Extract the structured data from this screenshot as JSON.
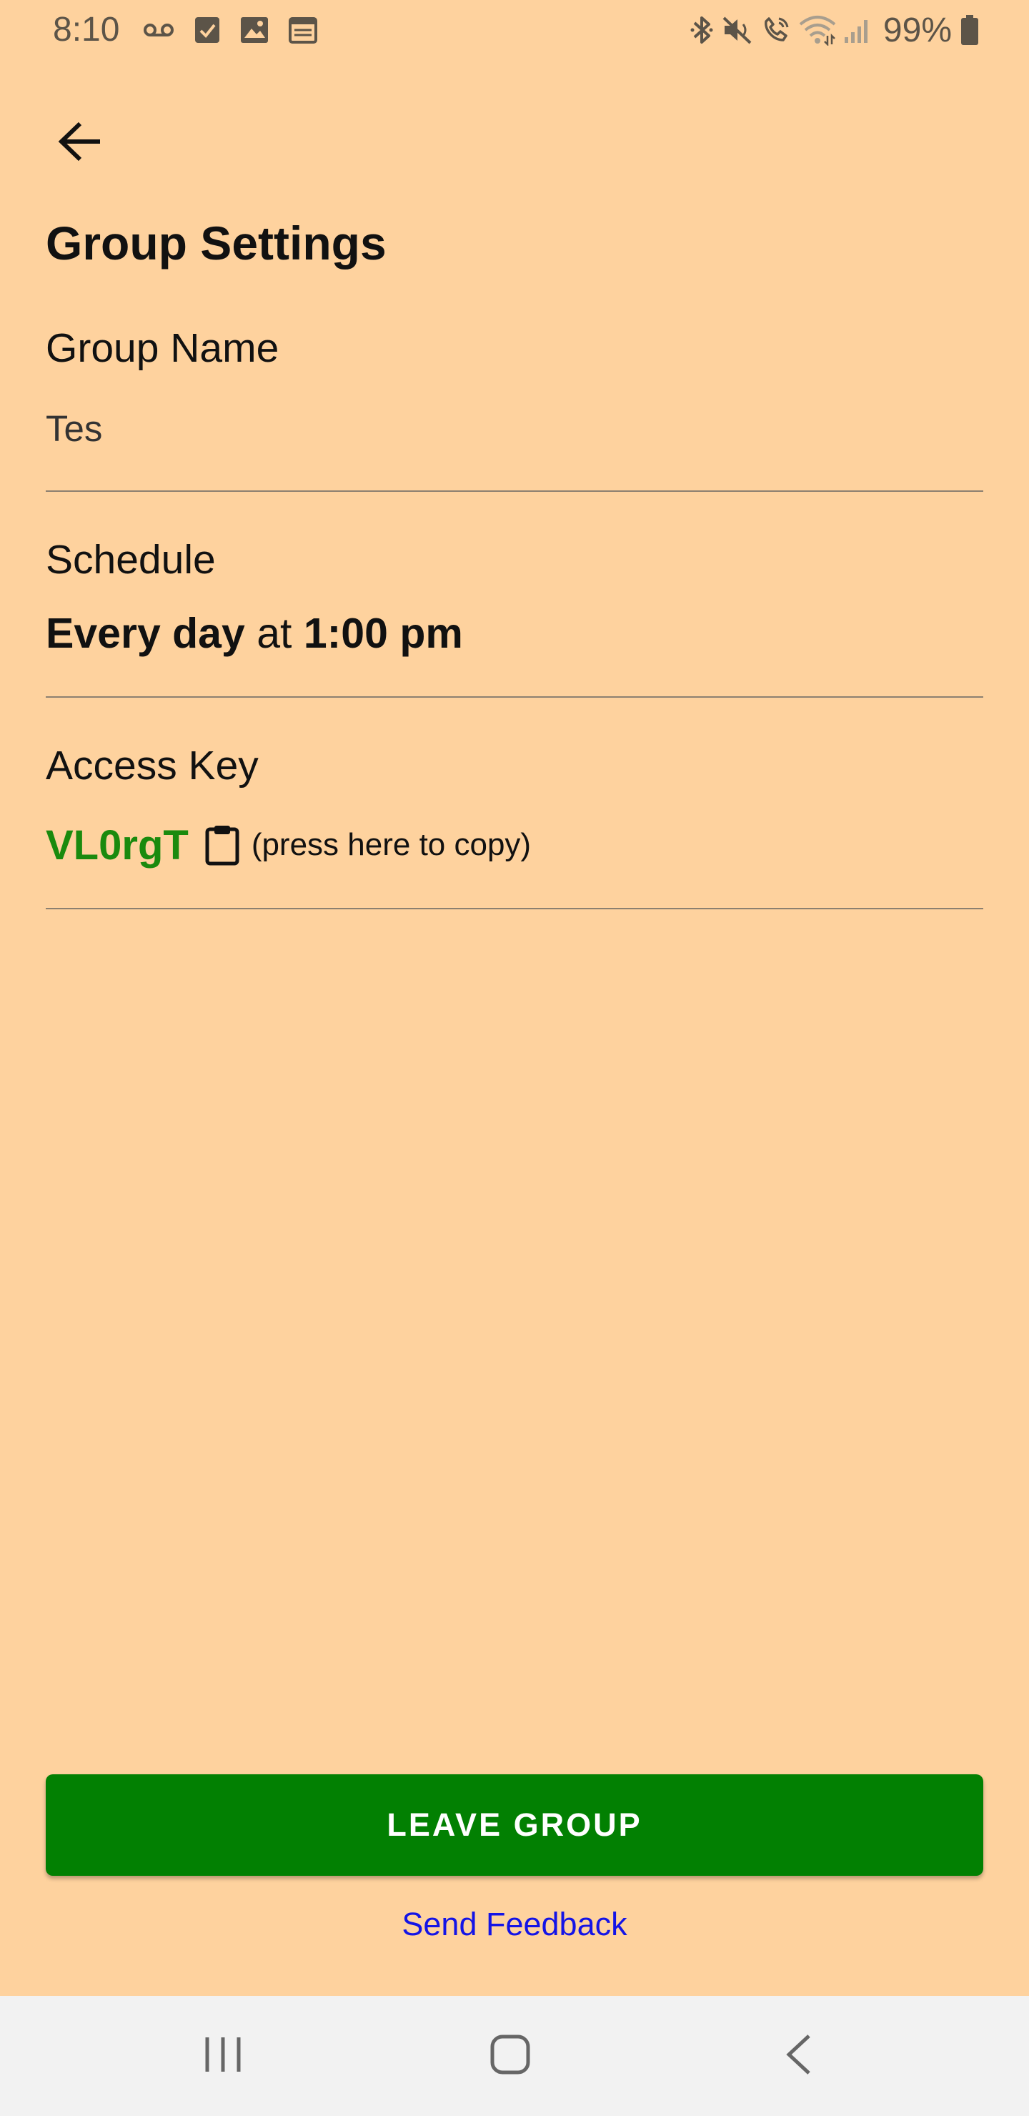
{
  "status_bar": {
    "time": "8:10",
    "battery_text": "99%",
    "left_icons": [
      "voicemail-icon",
      "checkbox-icon",
      "image-icon",
      "calendar-icon"
    ],
    "right_icons": [
      "bluetooth-icon",
      "mute-icon",
      "wifi-calling-icon",
      "wifi-icon",
      "signal-icon",
      "battery-icon"
    ]
  },
  "header": {
    "back_icon": "arrow-left-icon",
    "title": "Group Settings"
  },
  "group_name": {
    "label": "Group Name",
    "value": "Tes",
    "placeholder": ""
  },
  "schedule": {
    "label": "Schedule",
    "frequency": "Every day",
    "connector": "at",
    "time": "1:00 pm"
  },
  "access_key": {
    "label": "Access Key",
    "key": "VL0rgT",
    "copy_icon": "clipboard-icon",
    "copy_hint": "(press here to copy)"
  },
  "actions": {
    "leave_label": "LEAVE GROUP",
    "feedback_label": "Send Feedback"
  },
  "nav_bar": {
    "icons": [
      "recent-apps-icon",
      "home-icon",
      "back-icon"
    ]
  },
  "colors": {
    "background": "#FED29E",
    "primary_button": "#028002",
    "access_key": "#1A8A0E",
    "link": "#1414E6",
    "nav_bar": "#F2F2F2"
  }
}
